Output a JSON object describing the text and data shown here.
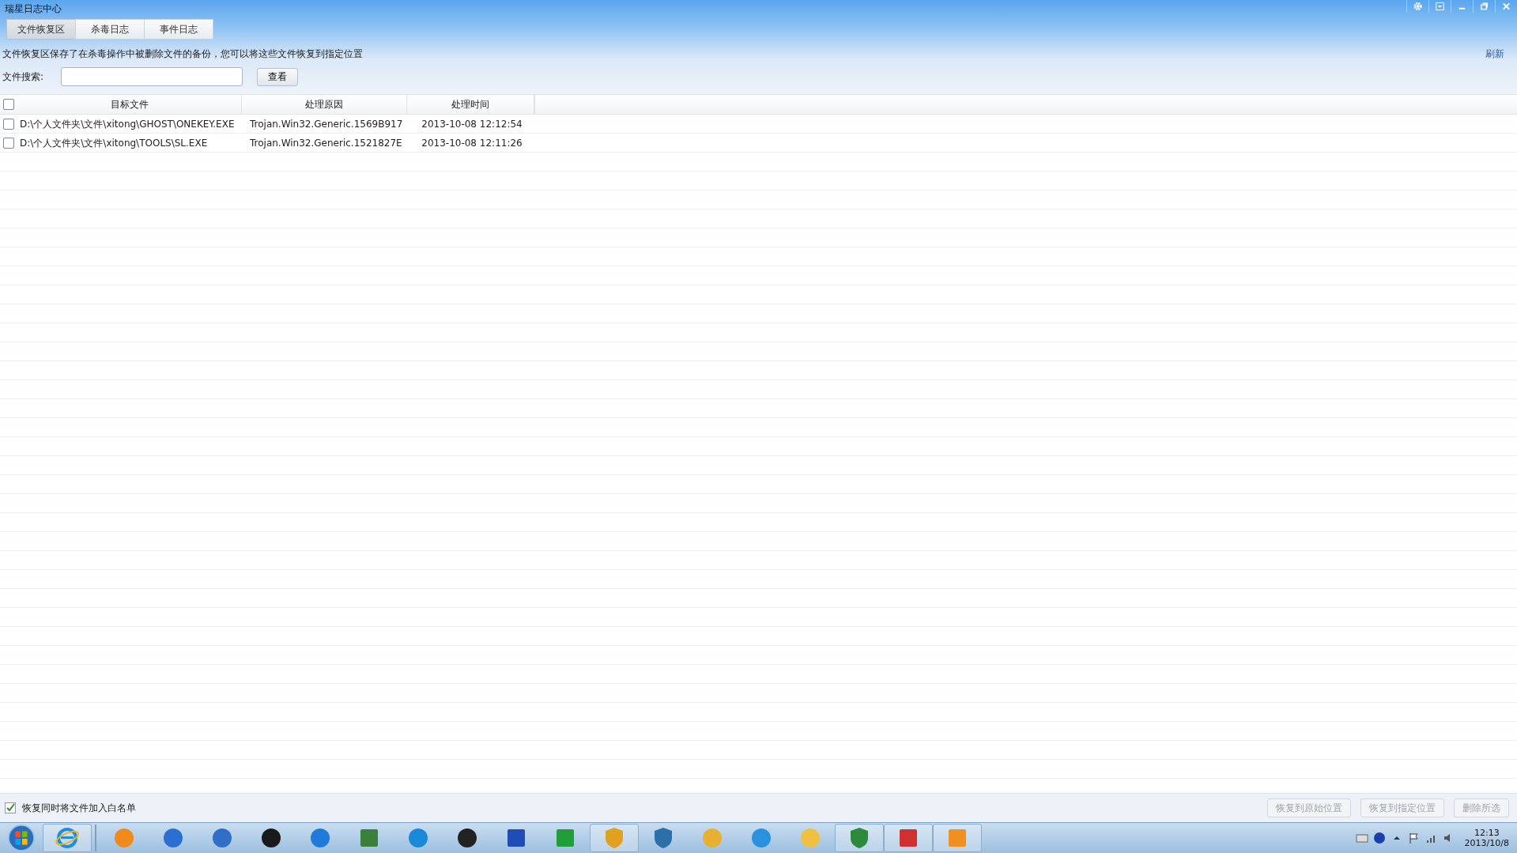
{
  "window": {
    "title": "瑞星日志中心"
  },
  "tabs": [
    {
      "label": "文件恢复区",
      "selected": true
    },
    {
      "label": "杀毒日志",
      "selected": false
    },
    {
      "label": "事件日志",
      "selected": false
    }
  ],
  "description": "文件恢复区保存了在杀毒操作中被删除文件的备份，您可以将这些文件恢复到指定位置",
  "refresh_link": "刷新",
  "search": {
    "label": "文件搜索:",
    "button": "查看"
  },
  "table": {
    "select_all": {
      "checked": false
    },
    "columns": [
      "目标文件",
      "处理原因",
      "处理时间"
    ],
    "rows": [
      {
        "checked": false,
        "cells": [
          "D:\\个人文件夹\\文件\\xitong\\GHOST\\ONEKEY.EXE",
          "Trojan.Win32.Generic.1569B917",
          "2013-10-08 12:12:54"
        ]
      },
      {
        "checked": false,
        "cells": [
          "D:\\个人文件夹\\文件\\xitong\\TOOLS\\SL.EXE",
          "Trojan.Win32.Generic.1521827E",
          "2013-10-08 12:11:26"
        ]
      }
    ]
  },
  "whitelist_option": {
    "label": "恢复同时将文件加入白名单",
    "checked": true
  },
  "actions": [
    {
      "label": "恢复到原始位置",
      "disabled": true
    },
    {
      "label": "恢复到指定位置",
      "disabled": true
    },
    {
      "label": "删除所选",
      "disabled": true
    }
  ],
  "taskbar": {
    "clock": {
      "time": "12:13",
      "date": "2013/10/8"
    }
  }
}
